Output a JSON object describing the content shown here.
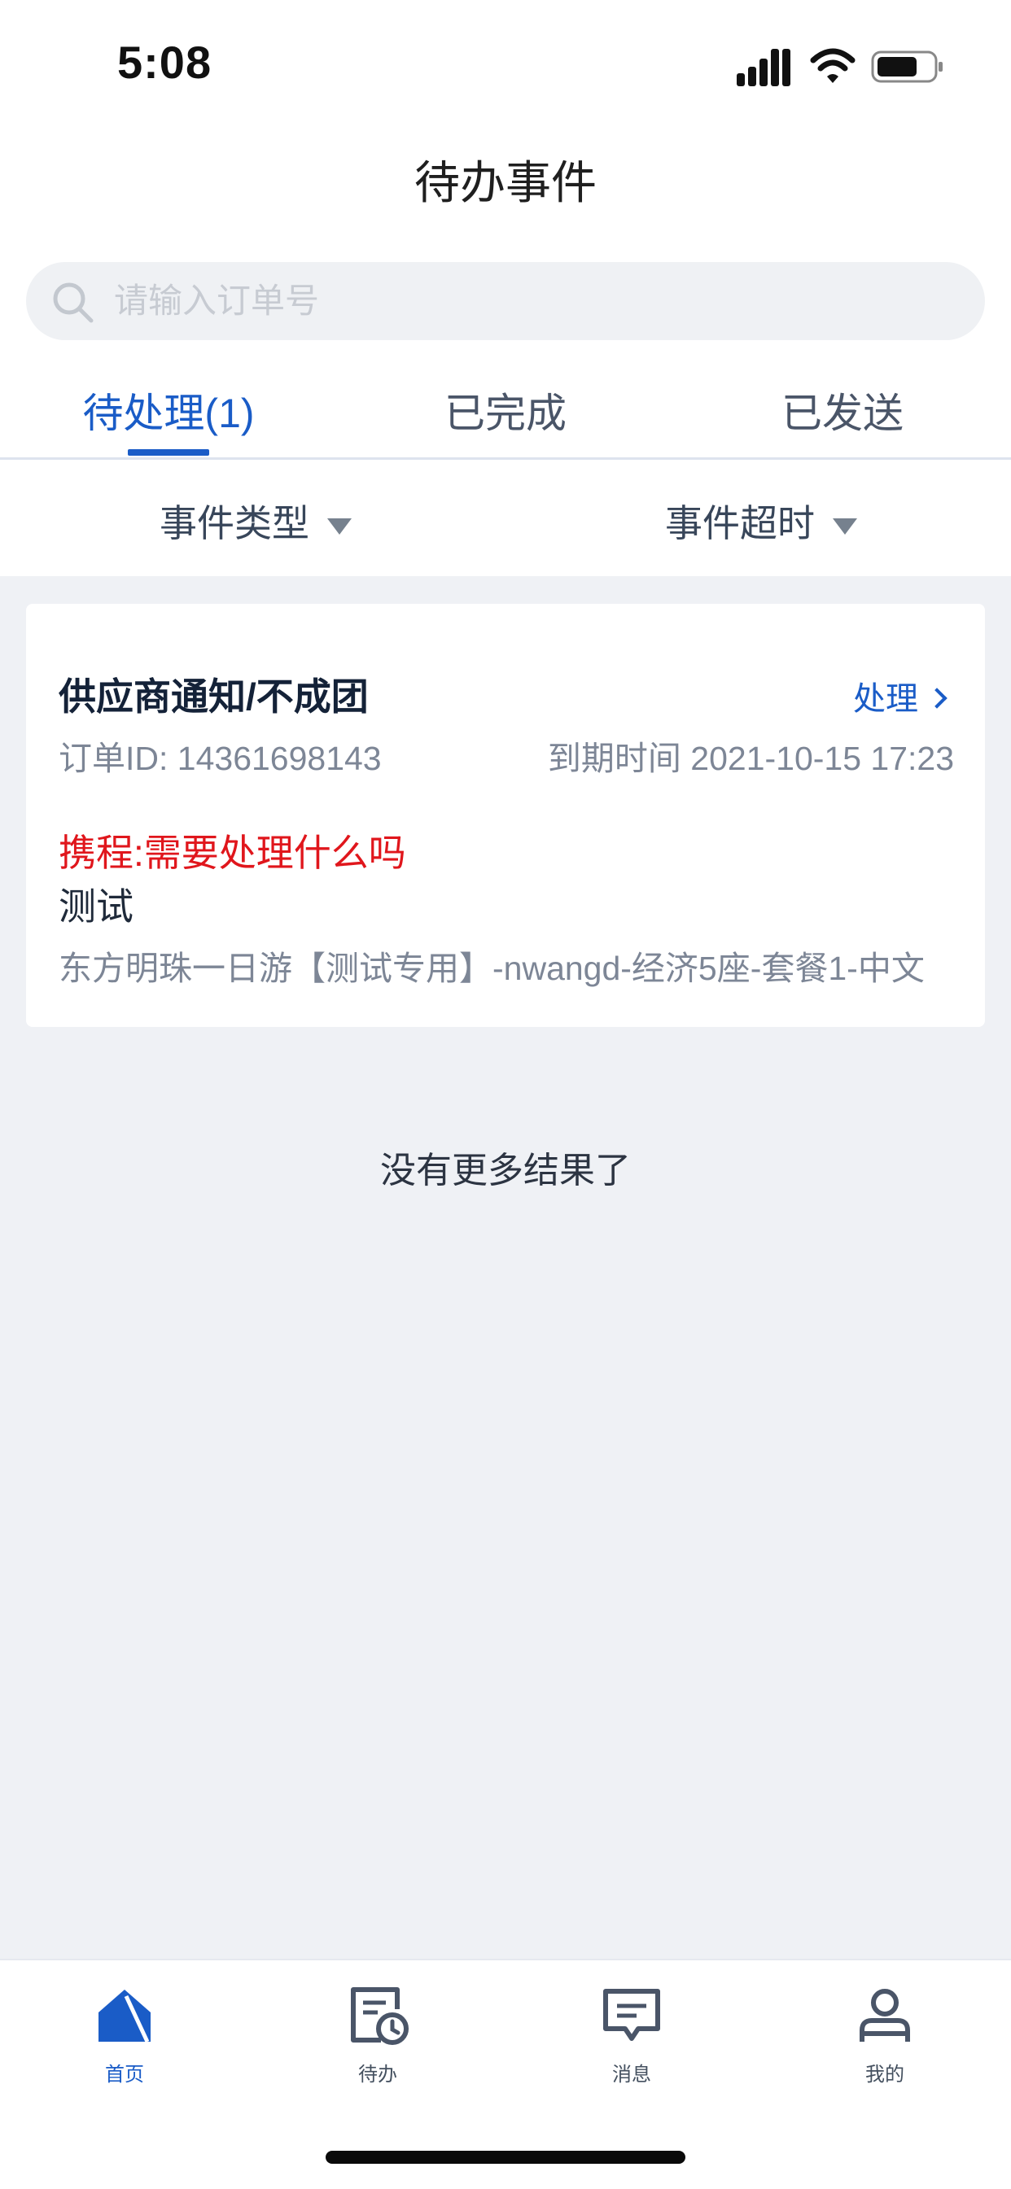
{
  "status_bar": {
    "time": "5:08"
  },
  "header": {
    "title": "待办事件"
  },
  "search": {
    "placeholder": "请输入订单号",
    "value": ""
  },
  "tabs": [
    {
      "label": "待处理(1)",
      "active": true
    },
    {
      "label": "已完成",
      "active": false
    },
    {
      "label": "已发送",
      "active": false
    }
  ],
  "filters": [
    {
      "label": "事件类型"
    },
    {
      "label": "事件超时"
    }
  ],
  "events": [
    {
      "title": "供应商通知/不成团",
      "action_label": "处理",
      "order_id": "订单ID: 14361698143",
      "due": "到期时间 2021-10-15 17:23",
      "note_highlight": "携程:需要处理什么吗",
      "note": "测试",
      "product": "东方明珠一日游【测试专用】-nwangd-经济5座-套餐1-中文"
    }
  ],
  "list_end_text": "没有更多结果了",
  "tabbar": {
    "items": [
      {
        "label": "首页",
        "icon": "home-icon",
        "active": true
      },
      {
        "label": "待办",
        "icon": "todo-clock-icon",
        "active": false
      },
      {
        "label": "消息",
        "icon": "message-icon",
        "active": false
      },
      {
        "label": "我的",
        "icon": "user-icon",
        "active": false
      }
    ]
  },
  "colors": {
    "accent": "#1a5cc7",
    "alert": "#e0161c",
    "background": "#eff1f5",
    "muted_text": "#7d8696"
  }
}
